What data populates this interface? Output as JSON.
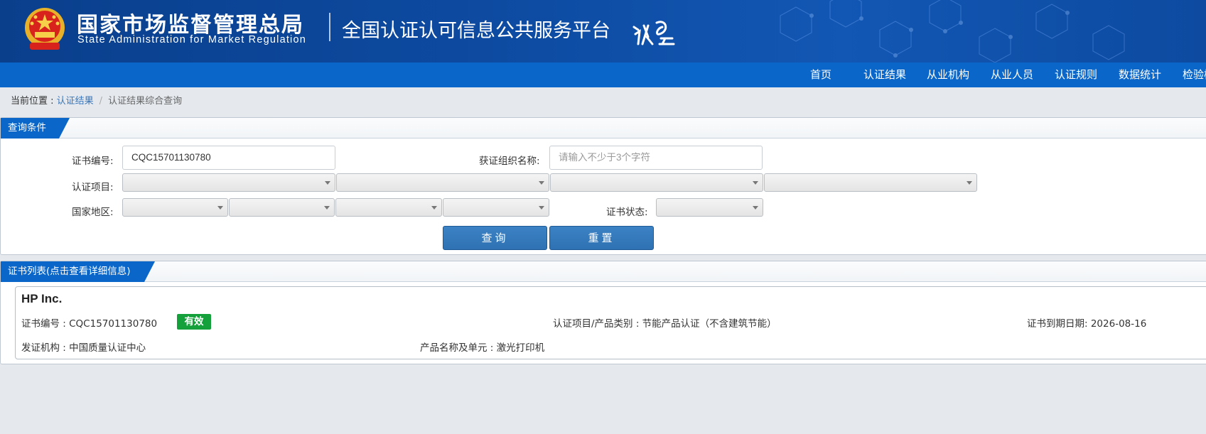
{
  "header": {
    "brand_cn": "国家市场监督管理总局",
    "brand_en": "State Administration  for  Market Regulation",
    "platform_title": "全国认证认可信息公共服务平台",
    "logo_icon": "emblem-icon",
    "platform_logo_icon": "renzheng-yun-logo-icon",
    "colors": {
      "banner": "#0d4aa0",
      "nav": "#0a67c9"
    }
  },
  "nav": {
    "items": [
      {
        "label": "首页"
      },
      {
        "label": "认证结果"
      },
      {
        "label": "从业机构"
      },
      {
        "label": "从业人员"
      },
      {
        "label": "认证规则"
      },
      {
        "label": "数据统计"
      },
      {
        "label": "检验检"
      }
    ]
  },
  "breadcrumb": {
    "prefix": "当前位置 : ",
    "link": "认证结果",
    "separator": "/",
    "current": "认证结果综合查询"
  },
  "query": {
    "title": "查询条件",
    "cert_no_label": "证书编号:",
    "cert_no_value": "CQC15701130780",
    "org_label": "获证组织名称:",
    "org_placeholder": "请输入不少于3个字符",
    "item_label": "认证项目:",
    "region_label": "国家地区:",
    "status_label": "证书状态:",
    "search_btn": "查询",
    "reset_btn": "重置"
  },
  "results": {
    "title": "证书列表(点击查看详细信息)",
    "items": [
      {
        "company": "HP Inc.",
        "cert_no": "证书编号 : CQC15701130780",
        "status": "有效",
        "category": "认证项目/产品类别 : 节能产品认证（不含建筑节能）",
        "expiry": "证书到期日期: 2026-08-16",
        "issuer": "发证机构 : 中国质量认证中心",
        "product": "产品名称及单元 : 激光打印机",
        "status_color": "#14a03a"
      }
    ]
  }
}
